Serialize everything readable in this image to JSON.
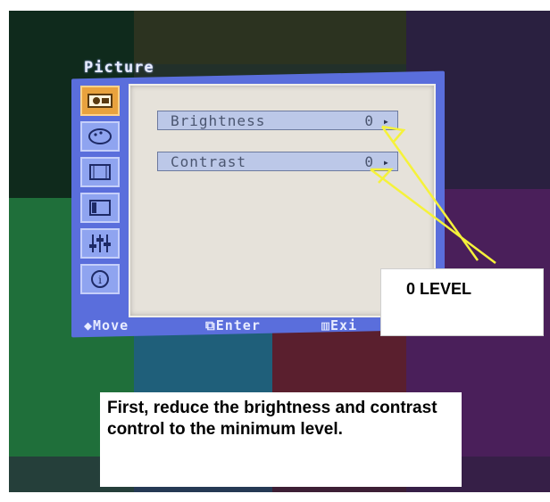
{
  "osd": {
    "title": "Picture",
    "menu_icons": [
      "picture-icon",
      "color-icon",
      "geometry-icon",
      "position-icon",
      "settings-icon",
      "info-icon"
    ],
    "items": [
      {
        "label": "Brightness",
        "value": "0"
      },
      {
        "label": "Contrast",
        "value": "0"
      }
    ],
    "footer": {
      "move": "◆Move",
      "enter": "⧉Enter",
      "exit": "▥Exi"
    },
    "colors": {
      "frame": "#5a6edc",
      "panel": "#e6e2da",
      "selected_icon": "#e8a23e",
      "annotation_arrow": "#f5f23a"
    }
  },
  "annotations": {
    "level_label": "0 LEVEL",
    "instruction": "First, reduce the brightness and contrast control to the minimum level."
  }
}
